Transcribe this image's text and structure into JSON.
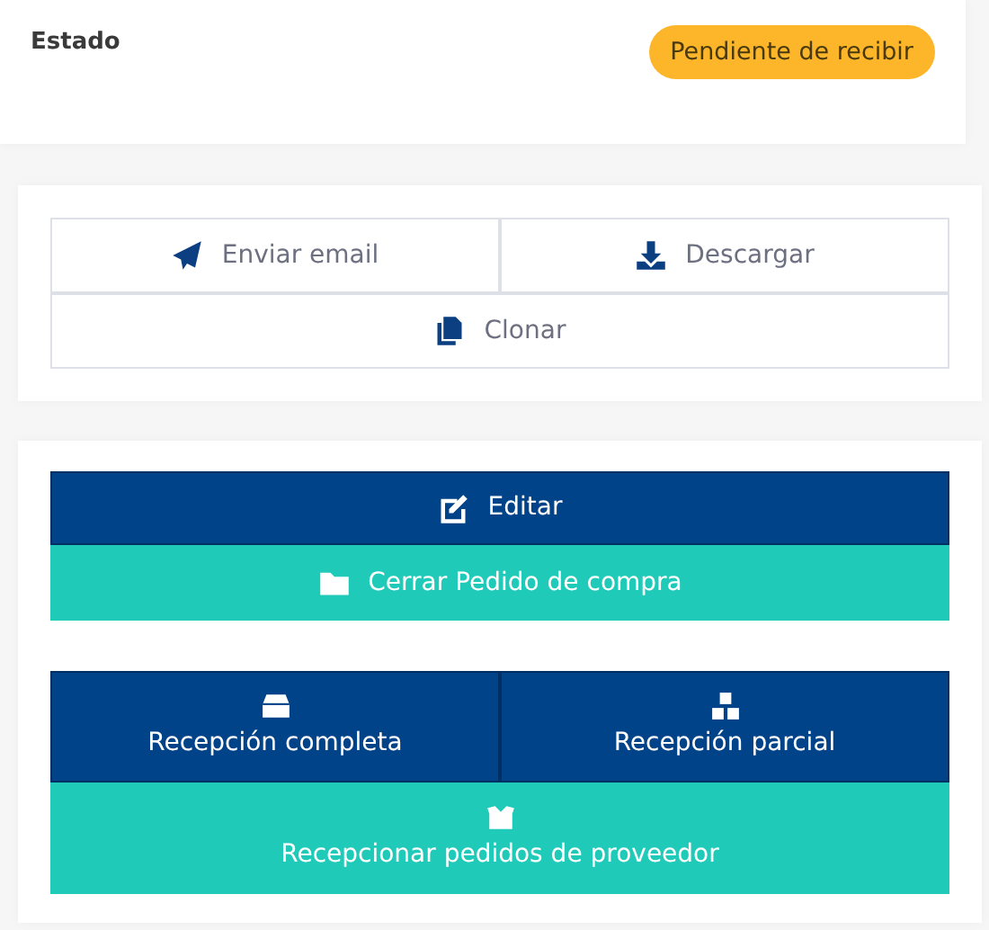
{
  "status": {
    "label": "Estado",
    "badge": "Pendiente de recibir"
  },
  "share_actions": [
    [
      {
        "label": "Enviar email",
        "kind": "outline"
      },
      {
        "label": "Descargar",
        "kind": "outline"
      }
    ],
    [
      {
        "label": "Clonar",
        "kind": "outline"
      }
    ]
  ],
  "main_actions": [
    [
      {
        "label": "Editar",
        "kind": "primary"
      }
    ],
    [
      {
        "label": "Cerrar Pedido de compra",
        "kind": "accent"
      }
    ]
  ],
  "reception_actions": [
    [
      {
        "label": "Recepción completa",
        "kind": "primary"
      },
      {
        "label": "Recepción parcial",
        "kind": "primary"
      }
    ],
    [
      {
        "label": "Recepcionar pedidos de proveedor",
        "kind": "accent"
      }
    ]
  ]
}
